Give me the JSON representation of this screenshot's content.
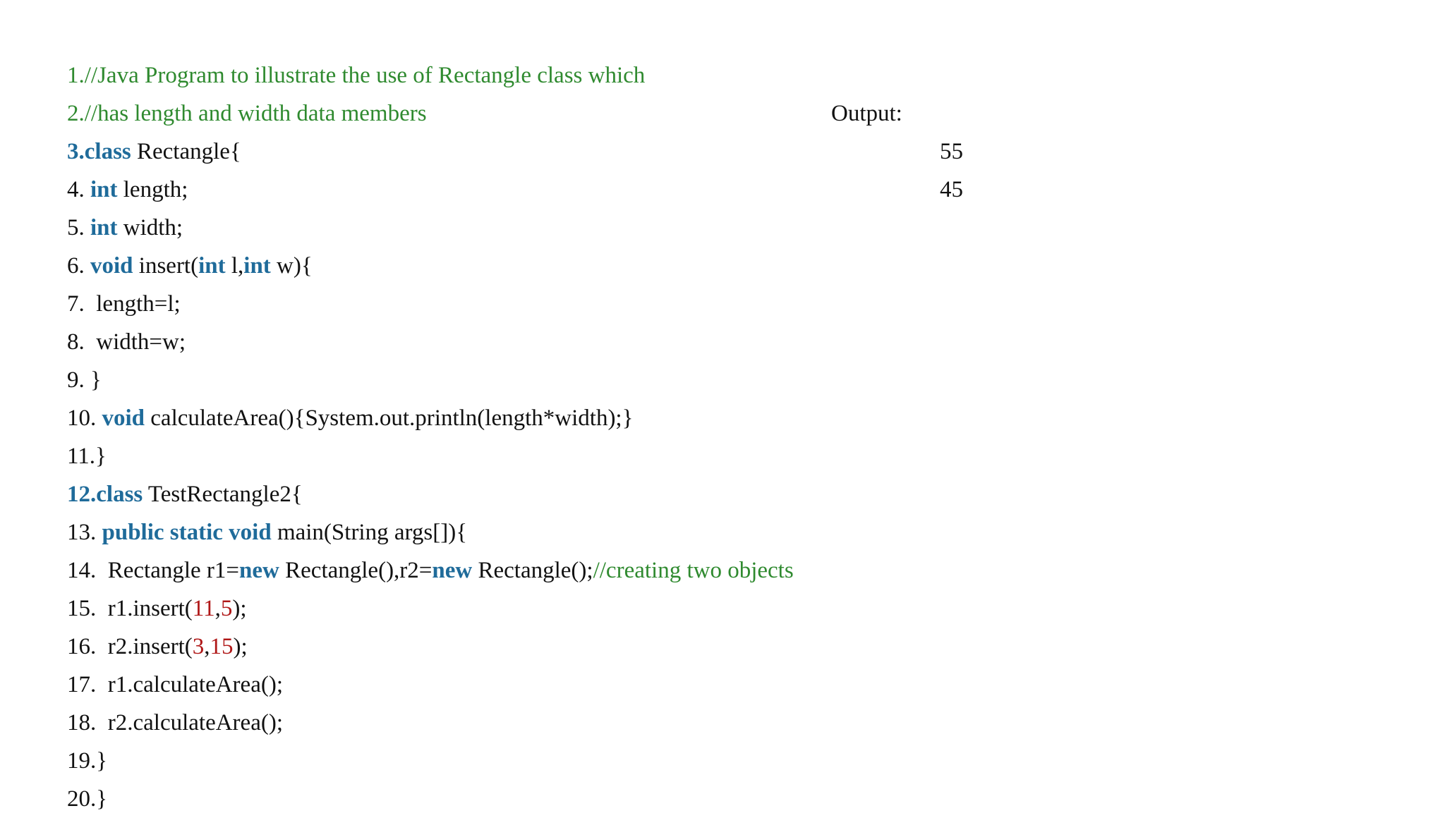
{
  "code_lines": [
    [
      {
        "t": "1.//Java Program to illustrate the use of Rectangle class which",
        "c": "c"
      }
    ],
    [
      {
        "t": "2.//has length and width data members",
        "c": "c"
      }
    ],
    [
      {
        "t": "3.class",
        "c": "k"
      },
      {
        "t": " Rectangle{",
        "c": "t"
      }
    ],
    [
      {
        "t": "4. ",
        "c": "t"
      },
      {
        "t": "int",
        "c": "k"
      },
      {
        "t": " length;",
        "c": "t"
      }
    ],
    [
      {
        "t": "5. ",
        "c": "t"
      },
      {
        "t": "int",
        "c": "k"
      },
      {
        "t": " width;",
        "c": "t"
      }
    ],
    [
      {
        "t": "6. ",
        "c": "t"
      },
      {
        "t": "void",
        "c": "k"
      },
      {
        "t": " insert(",
        "c": "t"
      },
      {
        "t": "int",
        "c": "k"
      },
      {
        "t": " l,",
        "c": "t"
      },
      {
        "t": "int",
        "c": "k"
      },
      {
        "t": " w){",
        "c": "t"
      }
    ],
    [
      {
        "t": "7.  length=l;",
        "c": "t"
      }
    ],
    [
      {
        "t": "8.  width=w;",
        "c": "t"
      }
    ],
    [
      {
        "t": "9. }",
        "c": "t"
      }
    ],
    [
      {
        "t": "10. ",
        "c": "t"
      },
      {
        "t": "void",
        "c": "k"
      },
      {
        "t": " calculateArea(){System.out.println(length*width);}",
        "c": "t"
      }
    ],
    [
      {
        "t": "11.}",
        "c": "t"
      }
    ],
    [
      {
        "t": "12.class",
        "c": "k"
      },
      {
        "t": " TestRectangle2{",
        "c": "t"
      }
    ],
    [
      {
        "t": "13. ",
        "c": "t"
      },
      {
        "t": "public static void",
        "c": "k"
      },
      {
        "t": " main(String args[]){",
        "c": "t"
      }
    ],
    [
      {
        "t": "14.  Rectangle r1=",
        "c": "t"
      },
      {
        "t": "new",
        "c": "k"
      },
      {
        "t": " Rectangle(),r2=",
        "c": "t"
      },
      {
        "t": "new",
        "c": "k"
      },
      {
        "t": " Rectangle();",
        "c": "t"
      },
      {
        "t": "//creating two objects",
        "c": "c"
      }
    ],
    [
      {
        "t": "15.  r1.insert(",
        "c": "t"
      },
      {
        "t": "11",
        "c": "n"
      },
      {
        "t": ",",
        "c": "t"
      },
      {
        "t": "5",
        "c": "n"
      },
      {
        "t": ");",
        "c": "t"
      }
    ],
    [
      {
        "t": "16.  r2.insert(",
        "c": "t"
      },
      {
        "t": "3",
        "c": "n"
      },
      {
        "t": ",",
        "c": "t"
      },
      {
        "t": "15",
        "c": "n"
      },
      {
        "t": ");",
        "c": "t"
      }
    ],
    [
      {
        "t": "17.  r1.calculateArea();",
        "c": "t"
      }
    ],
    [
      {
        "t": "18.  r2.calculateArea();",
        "c": "t"
      }
    ],
    [
      {
        "t": "19.}",
        "c": "t"
      }
    ],
    [
      {
        "t": "20.}",
        "c": "t"
      }
    ]
  ],
  "output": {
    "label": "Output:",
    "values": [
      "55",
      "45"
    ]
  },
  "colors": {
    "keyword": "#1f6b9a",
    "comment": "#2f8a2f",
    "number": "#b01818",
    "text": "#111111"
  }
}
